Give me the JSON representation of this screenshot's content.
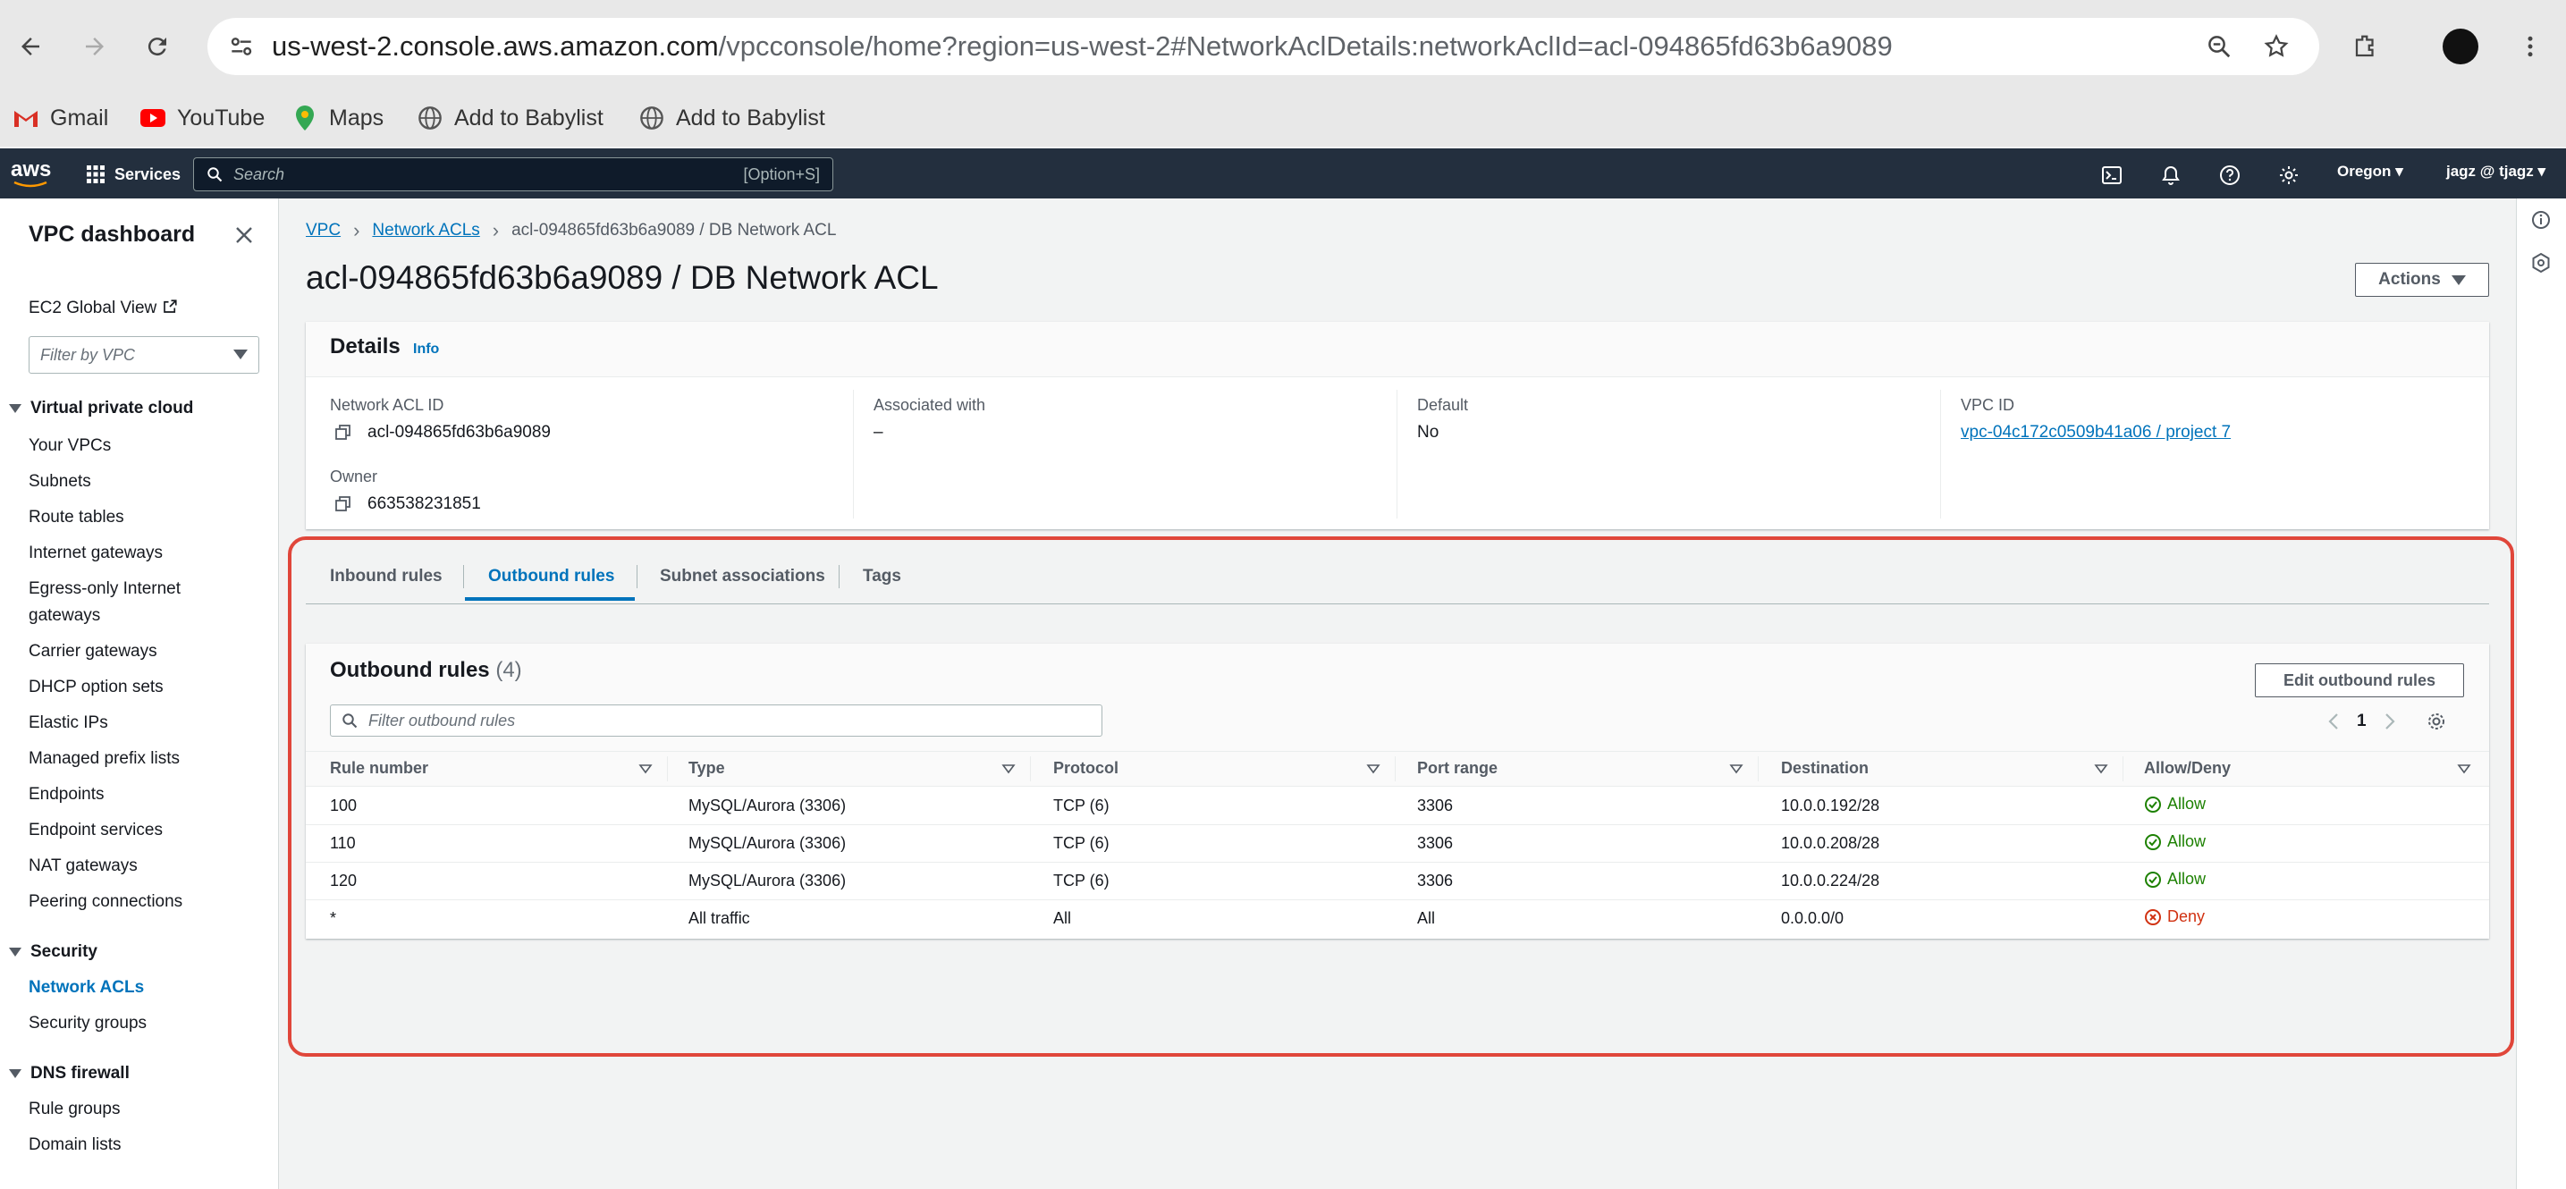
{
  "browser": {
    "url_host": "us-west-2.console.aws.amazon.com",
    "url_rest": "/vpcconsole/home?region=us-west-2#NetworkAclDetails:networkAclId=acl-094865fd63b6a9089",
    "bookmarks": [
      {
        "label": "Gmail",
        "icon": "gmail-icon"
      },
      {
        "label": "YouTube",
        "icon": "youtube-icon"
      },
      {
        "label": "Maps",
        "icon": "maps-icon"
      },
      {
        "label": "Add to Babylist",
        "icon": "globe-icon"
      },
      {
        "label": "Add to Babylist",
        "icon": "globe-icon"
      }
    ]
  },
  "aws_nav": {
    "logo": "aws",
    "services_label": "Services",
    "search_placeholder": "Search",
    "search_shortcut": "[Option+S]",
    "region": "Oregon",
    "account": "jagz @ tjagz"
  },
  "sidebar": {
    "title": "VPC dashboard",
    "ec2_global_view": "EC2 Global View",
    "filter_placeholder": "Filter by VPC",
    "sections": {
      "vpc": {
        "heading": "Virtual private cloud",
        "items": [
          "Your VPCs",
          "Subnets",
          "Route tables",
          "Internet gateways",
          "Egress-only Internet",
          "gateways",
          "Carrier gateways",
          "DHCP option sets",
          "Elastic IPs",
          "Managed prefix lists",
          "Endpoints",
          "Endpoint services",
          "NAT gateways",
          "Peering connections"
        ]
      },
      "security": {
        "heading": "Security",
        "items": [
          "Network ACLs",
          "Security groups"
        ]
      },
      "dns": {
        "heading": "DNS firewall",
        "items": [
          "Rule groups",
          "Domain lists"
        ]
      }
    }
  },
  "breadcrumb": {
    "vpc": "VPC",
    "network_acls": "Network ACLs",
    "current": "acl-094865fd63b6a9089 / DB Network ACL"
  },
  "page": {
    "title": "acl-094865fd63b6a9089 / DB Network ACL",
    "actions_label": "Actions"
  },
  "details": {
    "title": "Details",
    "info": "Info",
    "acl_id_label": "Network ACL ID",
    "acl_id": "acl-094865fd63b6a9089",
    "owner_label": "Owner",
    "owner": "663538231851",
    "associated_label": "Associated with",
    "associated": "–",
    "default_label": "Default",
    "default": "No",
    "vpc_id_label": "VPC ID",
    "vpc_id": "vpc-04c172c0509b41a06 / project 7"
  },
  "tabs": [
    "Inbound rules",
    "Outbound rules",
    "Subnet associations",
    "Tags"
  ],
  "rules": {
    "title": "Outbound rules",
    "count": "(4)",
    "edit_label": "Edit outbound rules",
    "filter_placeholder": "Filter outbound rules",
    "page": "1",
    "columns": [
      "Rule number",
      "Type",
      "Protocol",
      "Port range",
      "Destination",
      "Allow/Deny"
    ],
    "rows": [
      {
        "rule": "100",
        "type": "MySQL/Aurora (3306)",
        "protocol": "TCP (6)",
        "port": "3306",
        "dest": "10.0.0.192/28",
        "action": "Allow"
      },
      {
        "rule": "110",
        "type": "MySQL/Aurora (3306)",
        "protocol": "TCP (6)",
        "port": "3306",
        "dest": "10.0.0.208/28",
        "action": "Allow"
      },
      {
        "rule": "120",
        "type": "MySQL/Aurora (3306)",
        "protocol": "TCP (6)",
        "port": "3306",
        "dest": "10.0.0.224/28",
        "action": "Allow"
      },
      {
        "rule": "*",
        "type": "All traffic",
        "protocol": "All",
        "port": "All",
        "dest": "0.0.0.0/0",
        "action": "Deny"
      }
    ]
  },
  "colors": {
    "aws_nav": "#232f3e",
    "link": "#0073bb",
    "allow": "#1d8102",
    "deny": "#d13212",
    "highlight": "#e0463a"
  }
}
